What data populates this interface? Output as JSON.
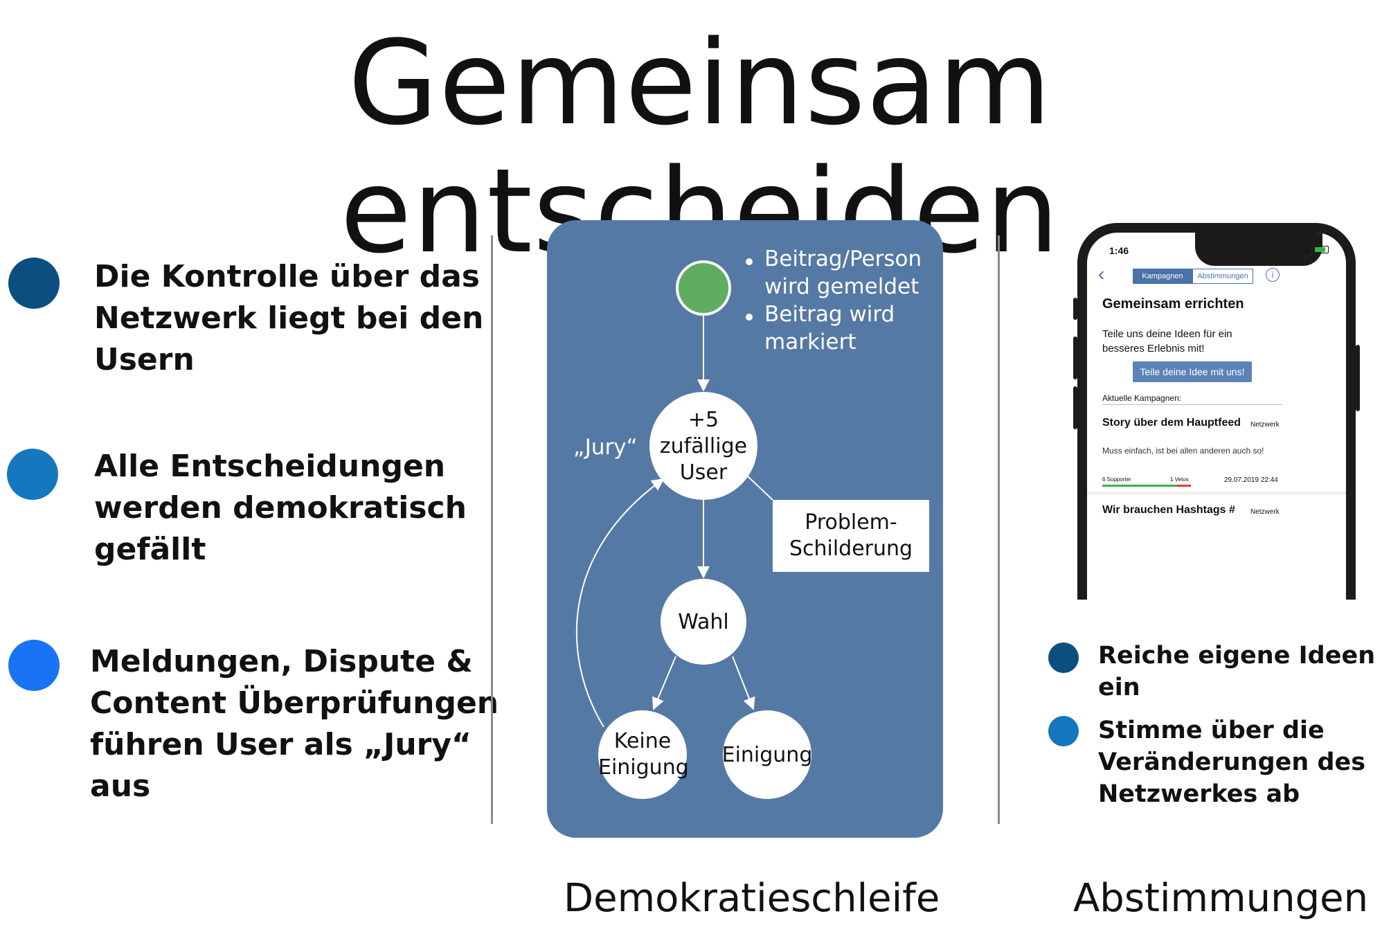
{
  "title": "Gemeinsam entscheiden",
  "left_bullets": [
    {
      "lines": [
        "Die Kontrolle über das",
        "Netzwerk liegt bei den",
        "Usern"
      ],
      "color": "#0b4f80"
    },
    {
      "lines": [
        "Alle Entscheidungen",
        "werden demokratisch",
        "gefällt"
      ],
      "color": "#1577bd"
    },
    {
      "lines": [
        "Meldungen, Dispute &",
        "Content Überprüfungen",
        "führen User als „Jury“",
        "aus"
      ],
      "color": "#1a73f5"
    }
  ],
  "flow": {
    "start_notes": [
      {
        "lines": [
          "Beitrag/Person",
          "wird gemeldet"
        ]
      },
      {
        "lines": [
          "Beitrag wird",
          "markiert"
        ]
      }
    ],
    "jury_label": "„Jury“",
    "jury_node": [
      "+5",
      "zufällige",
      "User"
    ],
    "problem_box": [
      "Problem-",
      "Schilderung"
    ],
    "vote_node": "Wahl",
    "no_agreement_node": [
      "Keine",
      "Einigung"
    ],
    "agreement_node": "Einigung",
    "start_color": "#5fae5f",
    "panel_color": "#5579a5"
  },
  "phone": {
    "time": "1:46",
    "tabs": [
      "Kampagnen",
      "Abstimmungen"
    ],
    "heading": "Gemeinsam errichten",
    "intro": [
      "Teile uns deine Ideen für ein",
      "besseres Erlebnis mit!"
    ],
    "cta": "Teile deine Idee mit uns!",
    "section_label": "Aktuelle Kampagnen:",
    "campaigns": [
      {
        "title": "Story über dem Hauptfeed",
        "tag": "Netzwerk",
        "desc": "Muss einfach, ist bei allen anderen auch so!",
        "supporters": "6 Supporter",
        "vetos": "1 Vetos",
        "date": "29.07.2019 22:44"
      },
      {
        "title": "Wir brauchen Hashtags #",
        "tag": "Netzwerk"
      }
    ],
    "accent": "#4a72a8"
  },
  "right_bullets": [
    {
      "lines": [
        "Reiche eigene Ideen ein"
      ],
      "color": "#0b4f80"
    },
    {
      "lines": [
        "Stimme über die",
        "Veränderungen des",
        "Netzwerkes ab"
      ],
      "color": "#1577bd"
    }
  ],
  "captions": {
    "center": "Demokratieschleife",
    "right": "Abstimmungen"
  }
}
